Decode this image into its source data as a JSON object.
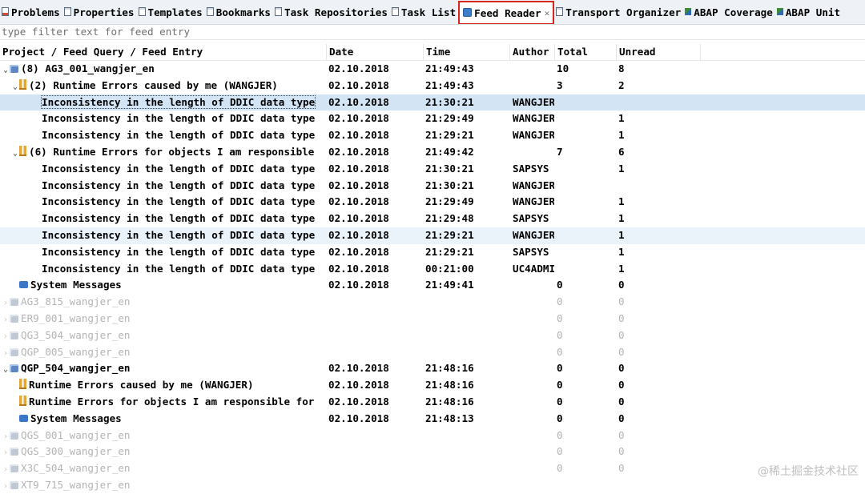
{
  "tabs": [
    {
      "id": "problems",
      "label": "Problems",
      "icon": "problems-icon",
      "kind": "red"
    },
    {
      "id": "properties",
      "label": "Properties",
      "icon": "properties-icon",
      "kind": "doc"
    },
    {
      "id": "templates",
      "label": "Templates",
      "icon": "templates-icon",
      "kind": "doc"
    },
    {
      "id": "bookmarks",
      "label": "Bookmarks",
      "icon": "bookmarks-icon",
      "kind": "doc"
    },
    {
      "id": "task-repositories",
      "label": "Task Repositories",
      "icon": "task-repositories-icon",
      "kind": "doc"
    },
    {
      "id": "task-list",
      "label": "Task List",
      "icon": "task-list-icon",
      "kind": "doc"
    },
    {
      "id": "feed-reader",
      "label": "Feed Reader",
      "icon": "feed-icon",
      "kind": "feed",
      "active": true,
      "close": "✕"
    },
    {
      "id": "transport-organizer",
      "label": "Transport Organizer",
      "icon": "transport-icon",
      "kind": "doc"
    },
    {
      "id": "abap-coverage",
      "label": "ABAP Coverage",
      "icon": "abap-coverage-icon",
      "kind": "abap"
    },
    {
      "id": "abap-unit",
      "label": "ABAP Unit",
      "icon": "abap-unit-icon",
      "kind": "abap"
    }
  ],
  "filter": {
    "placeholder": "type filter text for feed entry"
  },
  "columns": {
    "name": "Project / Feed Query / Feed Entry",
    "date": "Date",
    "time": "Time",
    "author": "Author",
    "total": "Total",
    "unread": "Unread"
  },
  "rows": [
    {
      "indent": 0,
      "twisty": "⌄",
      "icon": "proj",
      "name": "(8) AG3_001_wangjer_en",
      "date": "02.10.2018",
      "time": "21:49:43",
      "author": "",
      "total": "10",
      "unread": "8"
    },
    {
      "indent": 1,
      "twisty": "⌄",
      "icon": "rt",
      "name": "(2) Runtime Errors caused by me (WANGJER)",
      "date": "02.10.2018",
      "time": "21:49:43",
      "author": "",
      "total": "3",
      "unread": "2"
    },
    {
      "indent": 3,
      "twisty": "",
      "icon": "",
      "name": "Inconsistency in the length of DDIC data type",
      "date": "02.10.2018",
      "time": "21:30:21",
      "author": "WANGJER",
      "total": "",
      "unread": "",
      "state": "sel1"
    },
    {
      "indent": 3,
      "twisty": "",
      "icon": "",
      "name": "Inconsistency in the length of DDIC data type",
      "date": "02.10.2018",
      "time": "21:29:49",
      "author": "WANGJER",
      "total": "",
      "unread": "1"
    },
    {
      "indent": 3,
      "twisty": "",
      "icon": "",
      "name": "Inconsistency in the length of DDIC data type",
      "date": "02.10.2018",
      "time": "21:29:21",
      "author": "WANGJER",
      "total": "",
      "unread": "1"
    },
    {
      "indent": 1,
      "twisty": "⌄",
      "icon": "rt",
      "name": "(6) Runtime Errors for objects I am responsible",
      "date": "02.10.2018",
      "time": "21:49:42",
      "author": "",
      "total": "7",
      "unread": "6"
    },
    {
      "indent": 3,
      "twisty": "",
      "icon": "",
      "name": "Inconsistency in the length of DDIC data type",
      "date": "02.10.2018",
      "time": "21:30:21",
      "author": "SAPSYS",
      "total": "",
      "unread": "1"
    },
    {
      "indent": 3,
      "twisty": "",
      "icon": "",
      "name": "Inconsistency in the length of DDIC data type",
      "date": "02.10.2018",
      "time": "21:30:21",
      "author": "WANGJER",
      "total": "",
      "unread": ""
    },
    {
      "indent": 3,
      "twisty": "",
      "icon": "",
      "name": "Inconsistency in the length of DDIC data type",
      "date": "02.10.2018",
      "time": "21:29:49",
      "author": "WANGJER",
      "total": "",
      "unread": "1"
    },
    {
      "indent": 3,
      "twisty": "",
      "icon": "",
      "name": "Inconsistency in the length of DDIC data type",
      "date": "02.10.2018",
      "time": "21:29:48",
      "author": "SAPSYS",
      "total": "",
      "unread": "1"
    },
    {
      "indent": 3,
      "twisty": "",
      "icon": "",
      "name": "Inconsistency in the length of DDIC data type",
      "date": "02.10.2018",
      "time": "21:29:21",
      "author": "WANGJER",
      "total": "",
      "unread": "1",
      "state": "sel2"
    },
    {
      "indent": 3,
      "twisty": "",
      "icon": "",
      "name": "Inconsistency in the length of DDIC data type",
      "date": "02.10.2018",
      "time": "21:29:21",
      "author": "SAPSYS",
      "total": "",
      "unread": "1"
    },
    {
      "indent": 3,
      "twisty": "",
      "icon": "",
      "name": "Inconsistency in the length of DDIC data type",
      "date": "02.10.2018",
      "time": "00:21:00",
      "author": "UC4ADMI",
      "total": "",
      "unread": "1"
    },
    {
      "indent": 1,
      "twisty": "",
      "icon": "msg",
      "name": "System Messages",
      "date": "02.10.2018",
      "time": "21:49:41",
      "author": "",
      "total": "0",
      "unread": "0"
    },
    {
      "indent": 0,
      "twisty": "›",
      "icon": "proj",
      "name": "AG3_815_wangjer_en",
      "date": "",
      "time": "",
      "author": "",
      "total": "0",
      "unread": "0",
      "state": "dim"
    },
    {
      "indent": 0,
      "twisty": "›",
      "icon": "proj",
      "name": "ER9_001_wangjer_en",
      "date": "",
      "time": "",
      "author": "",
      "total": "0",
      "unread": "0",
      "state": "dim"
    },
    {
      "indent": 0,
      "twisty": "›",
      "icon": "proj",
      "name": "QG3_504_wangjer_en",
      "date": "",
      "time": "",
      "author": "",
      "total": "0",
      "unread": "0",
      "state": "dim"
    },
    {
      "indent": 0,
      "twisty": "›",
      "icon": "proj",
      "name": "QGP_005_wangjer_en",
      "date": "",
      "time": "",
      "author": "",
      "total": "0",
      "unread": "0",
      "state": "dim"
    },
    {
      "indent": 0,
      "twisty": "⌄",
      "icon": "proj",
      "name": "QGP_504_wangjer_en",
      "date": "02.10.2018",
      "time": "21:48:16",
      "author": "",
      "total": "0",
      "unread": "0"
    },
    {
      "indent": 1,
      "twisty": "",
      "icon": "rt",
      "name": "Runtime Errors caused by me (WANGJER)",
      "date": "02.10.2018",
      "time": "21:48:16",
      "author": "",
      "total": "0",
      "unread": "0"
    },
    {
      "indent": 1,
      "twisty": "",
      "icon": "rt",
      "name": "Runtime Errors for objects I am responsible for",
      "date": "02.10.2018",
      "time": "21:48:16",
      "author": "",
      "total": "0",
      "unread": "0"
    },
    {
      "indent": 1,
      "twisty": "",
      "icon": "msg",
      "name": "System Messages",
      "date": "02.10.2018",
      "time": "21:48:13",
      "author": "",
      "total": "0",
      "unread": "0"
    },
    {
      "indent": 0,
      "twisty": "›",
      "icon": "proj",
      "name": "QGS_001_wangjer_en",
      "date": "",
      "time": "",
      "author": "",
      "total": "0",
      "unread": "0",
      "state": "dim"
    },
    {
      "indent": 0,
      "twisty": "›",
      "icon": "proj",
      "name": "QGS_300_wangjer_en",
      "date": "",
      "time": "",
      "author": "",
      "total": "0",
      "unread": "0",
      "state": "dim"
    },
    {
      "indent": 0,
      "twisty": "›",
      "icon": "proj",
      "name": "X3C_504_wangjer_en",
      "date": "",
      "time": "",
      "author": "",
      "total": "0",
      "unread": "0",
      "state": "dim"
    },
    {
      "indent": 0,
      "twisty": "›",
      "icon": "proj",
      "name": "XT9_715_wangjer_en",
      "date": "",
      "time": "",
      "author": "",
      "total": "",
      "unread": "",
      "state": "dim"
    }
  ],
  "watermark": "@稀土掘金技术社区"
}
